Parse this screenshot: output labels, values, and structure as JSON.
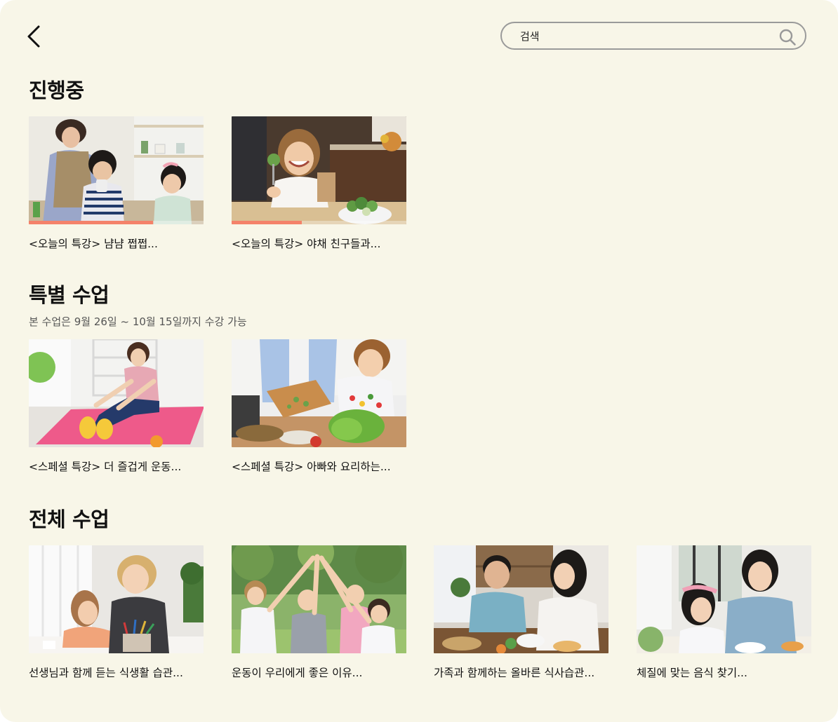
{
  "header": {
    "search_placeholder": "검색",
    "icons": {
      "back": "chevron-left-icon",
      "search": "search-icon"
    }
  },
  "in_progress": {
    "title": "진행중",
    "items": [
      {
        "title": "<오늘의 특강> 냠냠 쩝쩝...",
        "progress": 0.71,
        "image": "mother-and-kids-kitchen"
      },
      {
        "title": "<오늘의 특강> 야채 친구들과...",
        "progress": 0.4,
        "image": "girl-eating-broccoli"
      }
    ]
  },
  "special": {
    "title": "특별 수업",
    "subtitle": "본 수업은 9월 26일 ~ 10월 15일까지 수강 가능",
    "items": [
      {
        "title": "<스페셜 특강> 더 즐겁게 운동...",
        "image": "girl-stretching-yoga-mat"
      },
      {
        "title": "<스페셜 특강> 아빠와 요리하는...",
        "image": "father-son-cooking"
      }
    ]
  },
  "all": {
    "title": "전체 수업",
    "items": [
      {
        "title": "선생님과 함께 듣는 식생활 습관...",
        "image": "teacher-and-girl-studying"
      },
      {
        "title": "운동이 우리에게 좋은 이유...",
        "image": "kids-high-five-park"
      },
      {
        "title": "가족과 함께하는 올바른 식사습관...",
        "image": "family-dinner-table"
      },
      {
        "title": "체질에 맞는 음식 찾기...",
        "image": "mother-daughter-meal"
      }
    ]
  },
  "colors": {
    "background": "#f8f6e8",
    "progress": "#f4826a",
    "search_border": "#9a9a9a"
  }
}
